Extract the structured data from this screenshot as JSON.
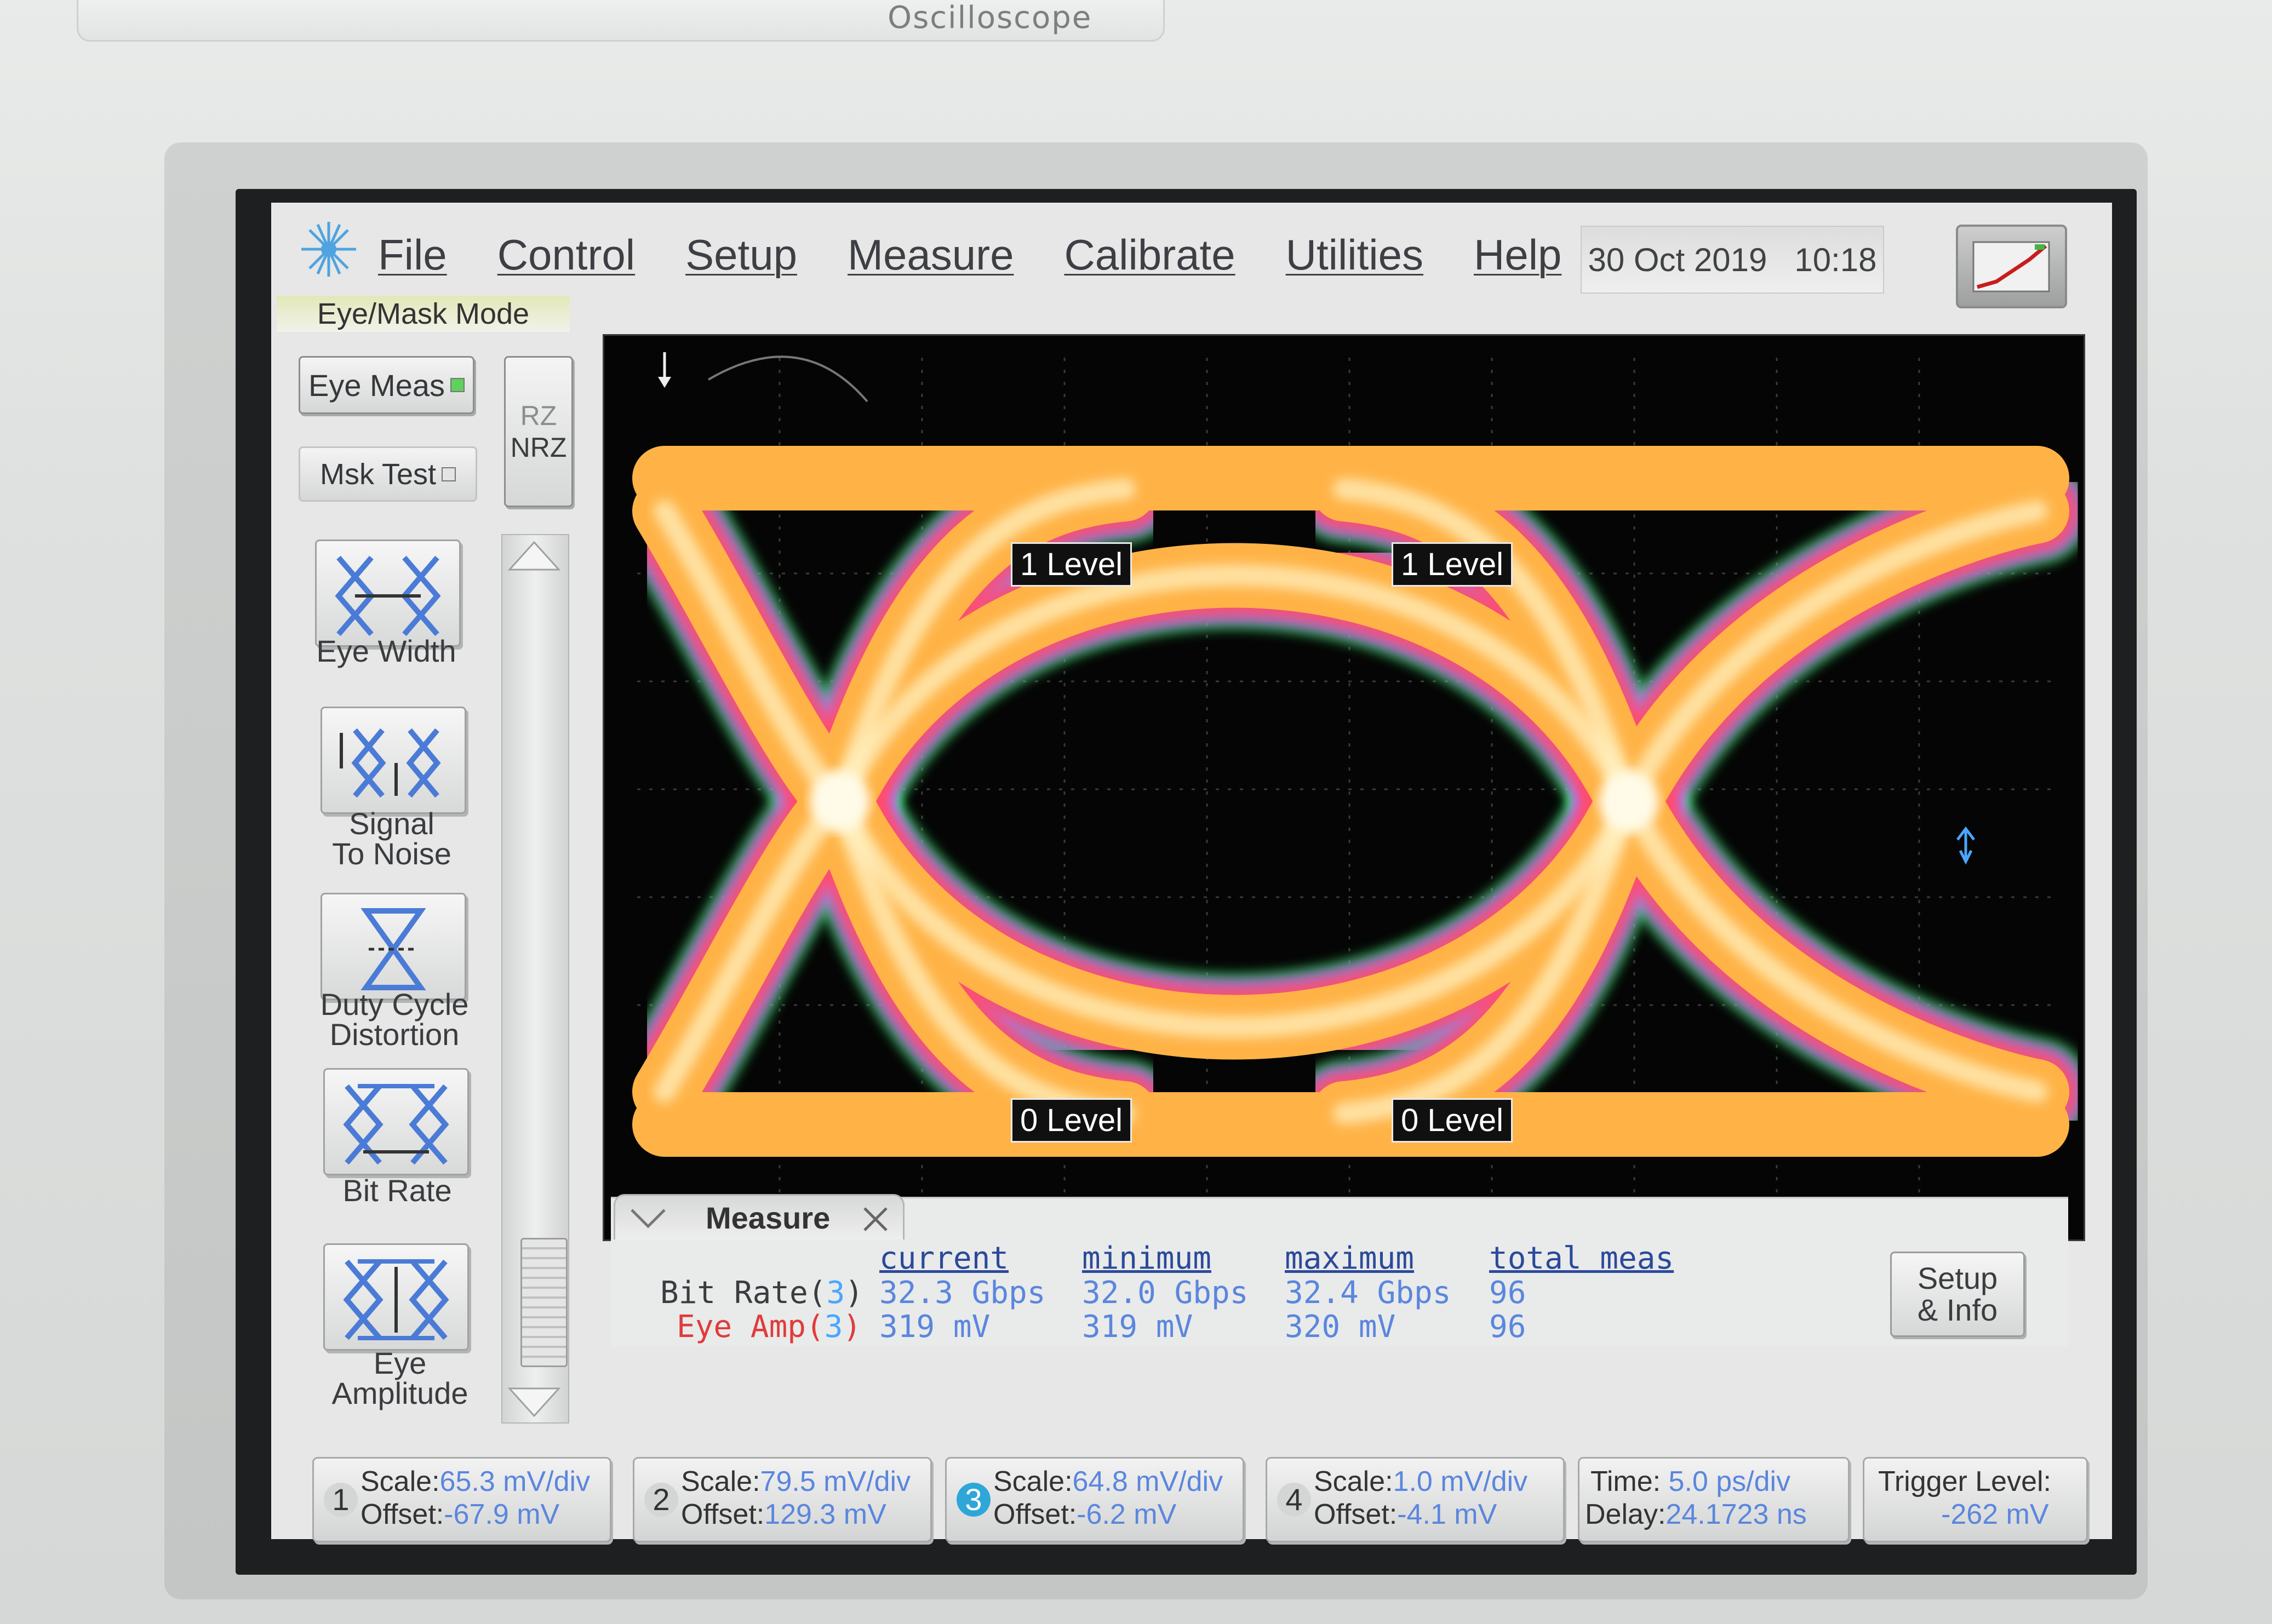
{
  "bezel": {
    "brand": "Oscilloscope"
  },
  "menu": {
    "items": [
      "File",
      "Control",
      "Setup",
      "Measure",
      "Calibrate",
      "Utilities",
      "Help"
    ],
    "date": "30 Oct 2019",
    "time": "10:18"
  },
  "mode": "Eye/Mask Mode",
  "left_panel": {
    "eye_meas": "Eye Meas",
    "msk_test": "Msk Test",
    "rz": "RZ",
    "nrz": "NRZ",
    "tools": [
      {
        "label_1": "Eye Width",
        "label_2": "",
        "icon": "eye-width-icon"
      },
      {
        "label_1": "Signal",
        "label_2": "To Noise",
        "icon": "signal-to-noise-icon"
      },
      {
        "label_1": "Duty Cycle",
        "label_2": "Distortion",
        "icon": "duty-cycle-distortion-icon"
      },
      {
        "label_1": "Bit Rate",
        "label_2": "",
        "icon": "bit-rate-icon"
      },
      {
        "label_1": "Eye",
        "label_2": "Amplitude",
        "icon": "eye-amplitude-icon"
      }
    ]
  },
  "waveform": {
    "markers": {
      "one_level_left": "1 Level",
      "one_level_right": "1 Level",
      "zero_level_left": "0 Level",
      "zero_level_right": "0 Level"
    },
    "colors": {
      "core": "#fff4c8",
      "mid": "#ffb347",
      "outer": "#ff4d6d",
      "edge": "#b070ff",
      "fringe": "#3aff6a"
    }
  },
  "measure": {
    "title": "Measure",
    "headers": [
      "current",
      "minimum",
      "maximum",
      "total meas"
    ],
    "rows": [
      {
        "label": "Bit Rate(",
        "channel": "3",
        "label_end": ")",
        "color": "#3a3c3f",
        "current": "32.3 Gbps",
        "minimum": "32.0 Gbps",
        "maximum": "32.4 Gbps",
        "total": "96"
      },
      {
        "label": "Eye Amp(",
        "channel": "3",
        "label_end": ")",
        "color": "#e03b3b",
        "current": "319 mV",
        "minimum": "319 mV",
        "maximum": "320 mV",
        "total": "96"
      }
    ],
    "setup_line1": "Setup",
    "setup_line2": "& Info"
  },
  "channels": [
    {
      "num": "1",
      "scale": "65.3 mV/div",
      "offset": "-67.9 mV"
    },
    {
      "num": "2",
      "scale": "79.5 mV/div",
      "offset": "129.3 mV"
    },
    {
      "num": "3",
      "scale": "64.8 mV/div",
      "offset": "-6.2 mV"
    },
    {
      "num": "4",
      "scale": "1.0 mV/div",
      "offset": "-4.1 mV"
    }
  ],
  "labels": {
    "scale": "Scale:",
    "offset": "Offset:",
    "time": "Time:",
    "delay": "Delay:",
    "trigger": "Trigger Level:"
  },
  "timebase": {
    "time": "5.0 ps/div",
    "delay": "24.1723 ns"
  },
  "trigger": {
    "level": "-262 mV"
  }
}
